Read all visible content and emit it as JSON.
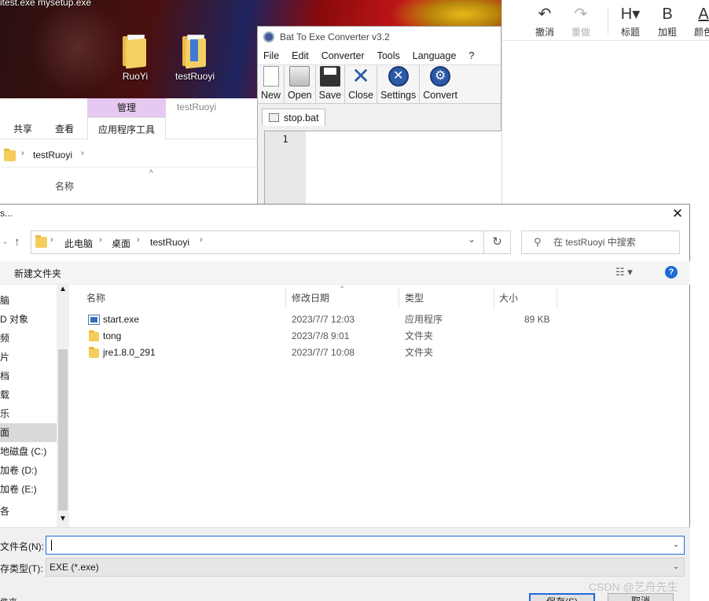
{
  "desktop": {
    "top_text": "itest.exe  mysetup.exe",
    "icons": [
      {
        "label": "RuoYi"
      },
      {
        "label": "testRuoyi"
      }
    ]
  },
  "explorer_bg": {
    "context_tab": "管理",
    "window_title": "testRuoyi",
    "tabs": [
      "共享",
      "查看",
      "应用程序工具"
    ],
    "address": "testRuoyi",
    "column_name": "名称"
  },
  "bat": {
    "title": "Bat To Exe Converter v3.2",
    "menu": [
      "File",
      "Edit",
      "Converter",
      "Tools",
      "Language",
      "?"
    ],
    "toolbar": [
      "New",
      "Open",
      "Save",
      "Close",
      "Settings",
      "Convert"
    ],
    "tab": "stop.bat",
    "line_number": "1"
  },
  "editor": {
    "buttons": [
      {
        "glyph": "↶",
        "label": "撤消",
        "disabled": false
      },
      {
        "glyph": "↷",
        "label": "重做",
        "disabled": true
      },
      {
        "glyph": "H▾",
        "label": "标题",
        "disabled": false
      },
      {
        "glyph": "B",
        "label": "加粗",
        "disabled": false
      },
      {
        "glyph": "A",
        "label": "颜色",
        "disabled": false
      }
    ]
  },
  "dialog": {
    "title": "s...",
    "breadcrumb": [
      "此电脑",
      "桌面",
      "testRuoyi"
    ],
    "search_placeholder": "在 testRuoyi 中搜索",
    "new_folder": "新建文件夹",
    "nav_items": [
      "脑",
      "D 对象",
      "频",
      "片",
      "档",
      "载",
      "乐",
      "面",
      "地磁盘 (C:)",
      "加卷 (D:)",
      "加卷 (E:)",
      "各"
    ],
    "nav_selected": "面",
    "columns": [
      "名称",
      "修改日期",
      "类型",
      "大小"
    ],
    "files": [
      {
        "name": "start.exe",
        "date": "2023/7/7 12:03",
        "type": "应用程序",
        "size": "89 KB",
        "icon": "exe-icon"
      },
      {
        "name": "tong",
        "date": "2023/7/8 9:01",
        "type": "文件夹",
        "size": "",
        "icon": "folder-icon"
      },
      {
        "name": "jre1.8.0_291",
        "date": "2023/7/7 10:08",
        "type": "文件夹",
        "size": "",
        "icon": "folder-icon"
      }
    ],
    "filename_label": "文件名(N):",
    "filename_value": "",
    "filetype_label": "存类型(T):",
    "filetype_value": "EXE (*.exe)",
    "hide_folders": "件夹",
    "save_button": "保存(S)",
    "cancel_button": "取消"
  },
  "watermark": "CSDN @艺舟先生",
  "colors": {
    "accent": "#1c6bd6",
    "folder": "#f4cd5c",
    "ribbon_context": "#e6c8f0"
  }
}
